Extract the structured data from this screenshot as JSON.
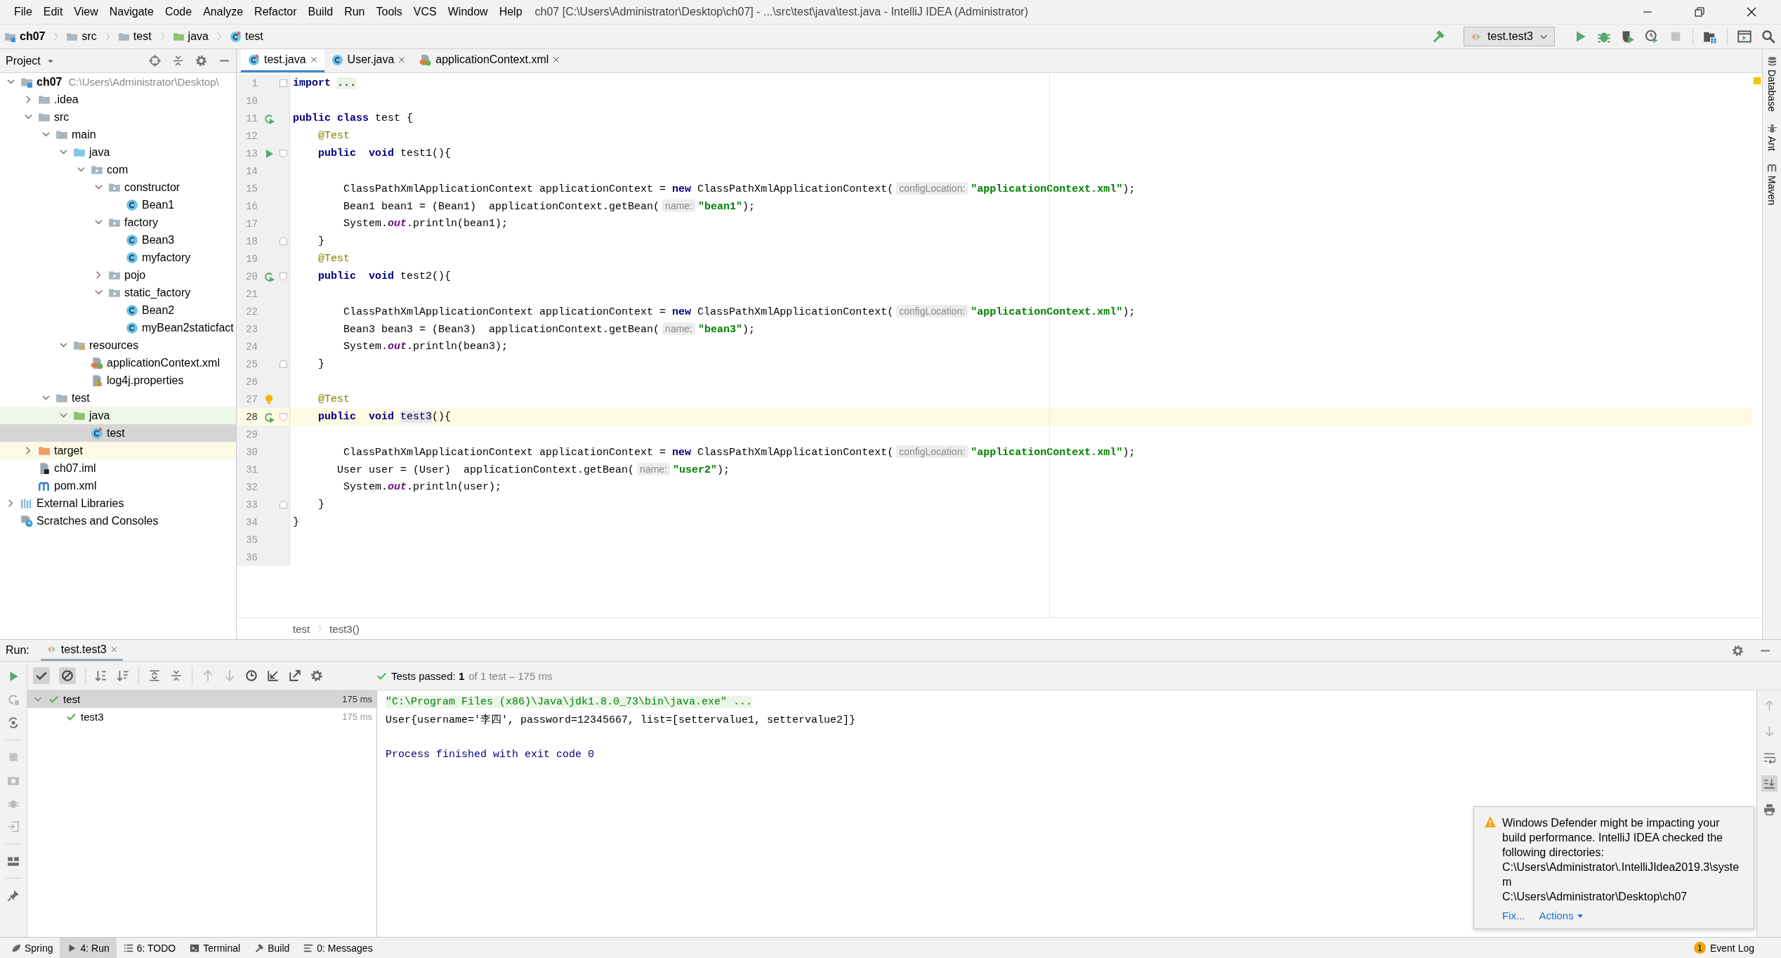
{
  "menu": [
    "File",
    "Edit",
    "View",
    "Navigate",
    "Code",
    "Analyze",
    "Refactor",
    "Build",
    "Run",
    "Tools",
    "VCS",
    "Window",
    "Help"
  ],
  "window_title": "ch07 [C:\\Users\\Administrator\\Desktop\\ch07] - ...\\src\\test\\java\\test.java - IntelliJ IDEA (Administrator)",
  "breadcrumbs": [
    {
      "label": "ch07",
      "kind": "module"
    },
    {
      "label": "src",
      "kind": "folder"
    },
    {
      "label": "test",
      "kind": "folder"
    },
    {
      "label": "java",
      "kind": "test-root"
    },
    {
      "label": "test",
      "kind": "test-class"
    }
  ],
  "run_config": "test.test3",
  "project": {
    "title": "Project",
    "tree": [
      {
        "label": "ch07",
        "kind": "module",
        "path": "C:\\Users\\Administrator\\Desktop\\",
        "expanded": true,
        "selected": false,
        "children": [
          {
            "label": ".idea",
            "kind": "folder",
            "expanded": false,
            "selected": false
          },
          {
            "label": "src",
            "kind": "folder",
            "expanded": true,
            "selected": false,
            "children": [
              {
                "label": "main",
                "kind": "folder",
                "expanded": true,
                "selected": false,
                "children": [
                  {
                    "label": "java",
                    "kind": "src-root",
                    "expanded": true,
                    "selected": false,
                    "children": [
                      {
                        "label": "com",
                        "kind": "package",
                        "expanded": true,
                        "selected": false,
                        "children": [
                          {
                            "label": "constructor",
                            "kind": "package",
                            "expanded": true,
                            "selected": false,
                            "children": [
                              {
                                "label": "Bean1",
                                "kind": "class",
                                "selected": false
                              }
                            ]
                          },
                          {
                            "label": "factory",
                            "kind": "package",
                            "expanded": true,
                            "selected": false,
                            "children": [
                              {
                                "label": "Bean3",
                                "kind": "class",
                                "selected": false
                              },
                              {
                                "label": "myfactory",
                                "kind": "class",
                                "selected": false
                              }
                            ]
                          },
                          {
                            "label": "pojo",
                            "kind": "package",
                            "expanded": false,
                            "selected": false
                          },
                          {
                            "label": "static_factory",
                            "kind": "package",
                            "expanded": true,
                            "selected": false,
                            "children": [
                              {
                                "label": "Bean2",
                                "kind": "class",
                                "selected": false
                              },
                              {
                                "label": "myBean2staticfact",
                                "kind": "class",
                                "selected": false
                              }
                            ]
                          }
                        ]
                      }
                    ]
                  },
                  {
                    "label": "resources",
                    "kind": "resources",
                    "expanded": true,
                    "selected": false,
                    "children": [
                      {
                        "label": "applicationContext.xml",
                        "kind": "xml",
                        "selected": false
                      },
                      {
                        "label": "log4j.properties",
                        "kind": "properties",
                        "selected": false
                      }
                    ]
                  }
                ]
              },
              {
                "label": "test",
                "kind": "folder",
                "expanded": true,
                "selected": false,
                "children": [
                  {
                    "label": "java",
                    "kind": "test-root",
                    "expanded": true,
                    "selected": false,
                    "children": [
                      {
                        "label": "test",
                        "kind": "test-class",
                        "selected": true
                      }
                    ]
                  }
                ]
              }
            ]
          },
          {
            "label": "target",
            "kind": "excluded",
            "expanded": false,
            "selected": false
          },
          {
            "label": "ch07.iml",
            "kind": "iml",
            "selected": false
          },
          {
            "label": "pom.xml",
            "kind": "maven",
            "selected": false
          }
        ]
      },
      {
        "label": "External Libraries",
        "kind": "libraries",
        "expanded": false,
        "selected": false
      },
      {
        "label": "Scratches and Consoles",
        "kind": "scratches",
        "selected": false
      }
    ]
  },
  "editor": {
    "tabs": [
      {
        "label": "test.java",
        "kind": "test-class",
        "selected": true
      },
      {
        "label": "User.java",
        "kind": "class",
        "selected": false
      },
      {
        "label": "applicationContext.xml",
        "kind": "xml",
        "selected": false
      }
    ],
    "lines": [
      {
        "number": "1",
        "fold": {
          "kind": "collapsed"
        },
        "current": false,
        "tokens": [
          {
            "text": "import ",
            "kind": "keyword"
          },
          {
            "text": "...",
            "kind": "folded"
          }
        ]
      },
      {
        "number": "10",
        "current": false
      },
      {
        "number": "11",
        "gutter": {
          "kind": "rerun"
        },
        "current": false,
        "tokens": [
          {
            "text": "public class",
            "kind": "keyword"
          },
          {
            "text": " test {"
          }
        ]
      },
      {
        "number": "12",
        "current": false,
        "tokens": [
          {
            "text": "    @Test",
            "kind": "annotation"
          }
        ]
      },
      {
        "number": "13",
        "gutter": {
          "kind": "run"
        },
        "fold": {
          "kind": "open"
        },
        "current": false,
        "tokens": [
          {
            "text": "    public  void",
            "kind": "keyword"
          },
          {
            "text": " test1(){"
          }
        ]
      },
      {
        "number": "14",
        "current": false
      },
      {
        "number": "15",
        "current": false,
        "tokens": [
          {
            "text": "        ClassPathXmlApplicationContext applicationContext = "
          },
          {
            "text": "new",
            "kind": "keyword"
          },
          {
            "text": " ClassPathXmlApplicationContext("
          },
          {
            "text": "configLocation:",
            "kind": "hint"
          },
          {
            "text": "\"applicationContext.xml\"",
            "kind": "string"
          },
          {
            "text": ");"
          }
        ]
      },
      {
        "number": "16",
        "current": false,
        "tokens": [
          {
            "text": "        Bean1 bean1 = (Bean1)  applicationContext.getBean("
          },
          {
            "text": "name:",
            "kind": "hint"
          },
          {
            "text": "\"bean1\"",
            "kind": "string"
          },
          {
            "text": ");"
          }
        ]
      },
      {
        "number": "17",
        "current": false,
        "tokens": [
          {
            "text": "        System."
          },
          {
            "text": "out",
            "kind": "field"
          },
          {
            "text": ".println(bean1);"
          }
        ]
      },
      {
        "number": "18",
        "fold": {
          "kind": "close"
        },
        "current": false,
        "tokens": [
          {
            "text": "    }"
          }
        ]
      },
      {
        "number": "19",
        "current": false,
        "tokens": [
          {
            "text": "    @Test",
            "kind": "annotation"
          }
        ]
      },
      {
        "number": "20",
        "gutter": {
          "kind": "rerun"
        },
        "fold": {
          "kind": "open"
        },
        "current": false,
        "tokens": [
          {
            "text": "    public  void",
            "kind": "keyword"
          },
          {
            "text": " test2(){"
          }
        ]
      },
      {
        "number": "21",
        "current": false
      },
      {
        "number": "22",
        "current": false,
        "tokens": [
          {
            "text": "        ClassPathXmlApplicationContext applicationContext = "
          },
          {
            "text": "new",
            "kind": "keyword"
          },
          {
            "text": " ClassPathXmlApplicationContext("
          },
          {
            "text": "configLocation:",
            "kind": "hint"
          },
          {
            "text": "\"applicationContext.xml\"",
            "kind": "string"
          },
          {
            "text": ");"
          }
        ]
      },
      {
        "number": "23",
        "current": false,
        "tokens": [
          {
            "text": "        Bean3 bean3 = (Bean3)  applicationContext.getBean("
          },
          {
            "text": "name:",
            "kind": "hint"
          },
          {
            "text": "\"bean3\"",
            "kind": "string"
          },
          {
            "text": ");"
          }
        ]
      },
      {
        "number": "24",
        "current": false,
        "tokens": [
          {
            "text": "        System."
          },
          {
            "text": "out",
            "kind": "field"
          },
          {
            "text": ".println(bean3);"
          }
        ]
      },
      {
        "number": "25",
        "fold": {
          "kind": "close"
        },
        "current": false,
        "tokens": [
          {
            "text": "    }"
          }
        ]
      },
      {
        "number": "26",
        "current": false
      },
      {
        "number": "27",
        "gutter": {
          "kind": "bulb"
        },
        "current": false,
        "tokens": [
          {
            "text": "    @Test",
            "kind": "annotation"
          }
        ]
      },
      {
        "number": "28",
        "gutter": {
          "kind": "rerun"
        },
        "fold": {
          "kind": "open"
        },
        "current": true,
        "tokens": [
          {
            "text": "    public  void ",
            "kind": "keyword"
          },
          {
            "text": "test3",
            "kind": "usage"
          },
          {
            "text": "(){"
          }
        ]
      },
      {
        "number": "29",
        "current": false
      },
      {
        "number": "30",
        "current": false,
        "tokens": [
          {
            "text": "        ClassPathXmlApplicationContext applicationContext = "
          },
          {
            "text": "new",
            "kind": "keyword"
          },
          {
            "text": " ClassPathXmlApplicationContext("
          },
          {
            "text": "configLocation:",
            "kind": "hint"
          },
          {
            "text": "\"applicationContext.xml\"",
            "kind": "string"
          },
          {
            "text": ");"
          }
        ]
      },
      {
        "number": "31",
        "current": false,
        "tokens": [
          {
            "text": "       User user = (User)  applicationContext.getBean("
          },
          {
            "text": "name:",
            "kind": "hint"
          },
          {
            "text": "\"user2\"",
            "kind": "string"
          },
          {
            "text": ");"
          }
        ]
      },
      {
        "number": "32",
        "current": false,
        "tokens": [
          {
            "text": "        System."
          },
          {
            "text": "out",
            "kind": "field"
          },
          {
            "text": ".println(user);"
          }
        ]
      },
      {
        "number": "33",
        "fold": {
          "kind": "close"
        },
        "current": false,
        "tokens": [
          {
            "text": "    }"
          }
        ]
      },
      {
        "number": "34",
        "current": false,
        "tokens": [
          {
            "text": "}"
          }
        ]
      },
      {
        "number": "35",
        "current": false
      },
      {
        "number": "36",
        "current": false
      }
    ],
    "breadcrumbs": [
      "test",
      "test3()"
    ]
  },
  "side_tools": [
    {
      "label": "Database",
      "kind": "database"
    },
    {
      "label": "Ant",
      "kind": "ant"
    },
    {
      "label": "Maven",
      "kind": "maven"
    }
  ],
  "run": {
    "label": "Run:",
    "tab": {
      "label": "test.test3",
      "selected": true
    },
    "filters": [
      {
        "kind": "passed",
        "on": true
      },
      {
        "kind": "ignored",
        "on": true
      }
    ],
    "summary": "Tests passed: **1**",
    "summary_detail": "of 1 test – 175 ms",
    "tests": [
      {
        "label": "test",
        "time": "175 ms",
        "selected": true,
        "expanded": true,
        "children": [
          {
            "label": "test3",
            "time": "175 ms",
            "selected": false
          }
        ]
      }
    ],
    "console": [
      {
        "text": "\"C:\\Program Files (x86)\\Java\\jdk1.8.0_73\\bin\\java.exe\" ...",
        "kind": "command"
      },
      {
        "text": "User{username='李四', password=12345667, list=[settervalue1, settervalue2]}",
        "kind": "output"
      },
      {
        "text": "Process finished with exit code 0",
        "kind": "exit"
      }
    ],
    "console_tools": [
      {
        "kind": "up",
        "on": false
      },
      {
        "kind": "down",
        "on": false
      },
      {
        "kind": "wrap",
        "on": false
      },
      {
        "kind": "scroll-end",
        "on": true
      },
      {
        "kind": "print",
        "on": false
      }
    ]
  },
  "notification": {
    "message": "Windows Defender might be impacting your build performance. IntelliJ IDEA checked the following directories:",
    "paths": [
      "C:\\Users\\Administrator\\.IntelliJIdea2019.3\\system",
      "C:\\Users\\Administrator\\Desktop\\ch07"
    ],
    "actions": [
      {
        "label": "Fix...",
        "kind": "link"
      },
      {
        "label": "Actions",
        "kind": "menu"
      }
    ]
  },
  "status_tools": [
    {
      "label": "Spring",
      "kind": "spring",
      "selected": false
    },
    {
      "label": "4: Run",
      "kind": "run",
      "selected": true
    },
    {
      "label": "6: TODO",
      "kind": "todo",
      "selected": false
    },
    {
      "label": "Terminal",
      "kind": "terminal",
      "selected": false
    },
    {
      "label": "Build",
      "kind": "build",
      "selected": false
    },
    {
      "label": "0: Messages",
      "kind": "messages",
      "selected": false
    }
  ],
  "event_log": {
    "label": "Event Log",
    "count": "1"
  }
}
